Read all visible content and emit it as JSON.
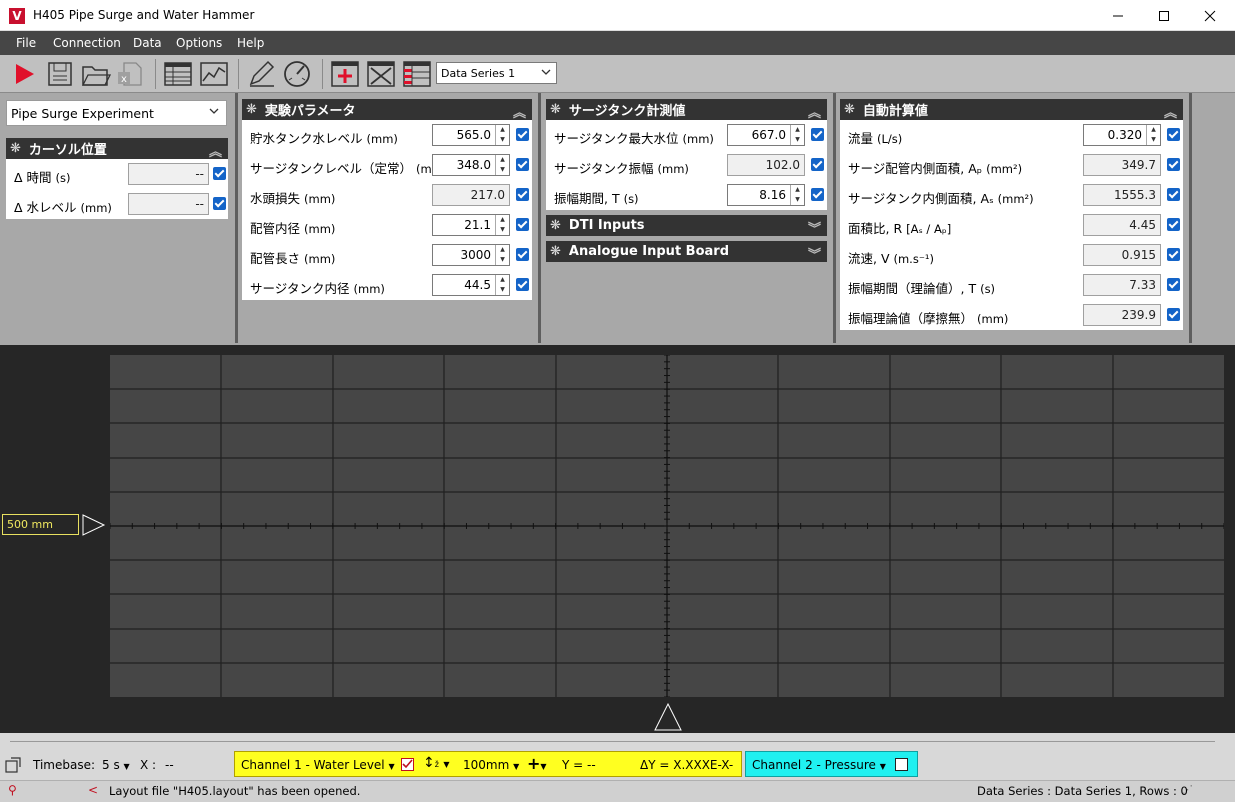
{
  "window": {
    "title": "H405 Pipe Surge and Water Hammer",
    "logo_letter": "V"
  },
  "menu": [
    "File",
    "Connection",
    "Data",
    "Options",
    "Help"
  ],
  "toolbar": {
    "series_select": "Data Series 1"
  },
  "experiment_select": "Pipe Surge Experiment",
  "cursor_panel": {
    "title": "カーソル位置",
    "rows": [
      {
        "label": "Δ 時間",
        "unit": "(s)",
        "value": "--"
      },
      {
        "label": "Δ 水レベル",
        "unit": "(mm)",
        "value": "--"
      }
    ]
  },
  "experiment_params": {
    "title": "実験パラメータ",
    "rows": [
      {
        "label": "貯水タンク水レベル",
        "unit": "(mm)",
        "value": "565.0"
      },
      {
        "label": "サージタンクレベル（定常）",
        "unit": "(mm)",
        "value": "348.0"
      },
      {
        "label": "水頭損失",
        "unit": "(mm)",
        "value": "217.0"
      },
      {
        "label": "配管内径",
        "unit": "(mm)",
        "value": "21.1"
      },
      {
        "label": "配管長さ",
        "unit": "(mm)",
        "value": "3000"
      },
      {
        "label": "サージタンク内径",
        "unit": "(mm)",
        "value": "44.5"
      }
    ]
  },
  "surge_measured": {
    "title": "サージタンク計測値",
    "rows": [
      {
        "label": "サージタンク最大水位",
        "unit": "(mm)",
        "value": "667.0"
      },
      {
        "label": "サージタンク振幅",
        "unit": "(mm)",
        "value": "102.0"
      },
      {
        "label": "振幅期間, T",
        "unit": "(s)",
        "value": "8.16"
      }
    ],
    "collapsed": [
      "DTI Inputs",
      "Analogue Input Board"
    ]
  },
  "auto_calc": {
    "title": "自動計算値",
    "rows": [
      {
        "label": "流量",
        "unit": "(L/s)",
        "value": "0.320"
      },
      {
        "label": "サージ配管内側面積, Aₚ",
        "unit": "(mm²)",
        "value": "349.7"
      },
      {
        "label": "サージタンク内側面積, Aₛ",
        "unit": "(mm²)",
        "value": "1555.3"
      },
      {
        "label": "面積比, R",
        "unit": "[Aₛ / Aₚ]",
        "value": "4.45"
      },
      {
        "label": "流速, V",
        "unit": "(m.s⁻¹)",
        "value": "0.915"
      },
      {
        "label": "振幅期間（理論値）, T",
        "unit": "(s)",
        "value": "7.33"
      },
      {
        "label": "振幅理論値（摩擦無）",
        "unit": "(mm)",
        "value": "239.9"
      }
    ]
  },
  "scope": {
    "marker_label": "500 mm"
  },
  "bottom": {
    "timebase_label": "Timebase:",
    "timebase_value": "5 s",
    "x_label": "X :",
    "x_value": "--",
    "channel1": {
      "name": "Channel 1 - Water Level",
      "range": "100mm",
      "y": "Y = --",
      "dy": "ΔY = X.XXXE-X-"
    },
    "channel2": {
      "name": "Channel 2 - Pressure"
    }
  },
  "status": {
    "message": "Layout file \"H405.layout\" has been opened.",
    "series_info": "Data Series : Data Series 1,  Rows : 0"
  },
  "colors": {
    "channel1": "#ffff20",
    "channel2": "#20f0f0",
    "header": "#333333",
    "checkbox": "#1464c8"
  }
}
